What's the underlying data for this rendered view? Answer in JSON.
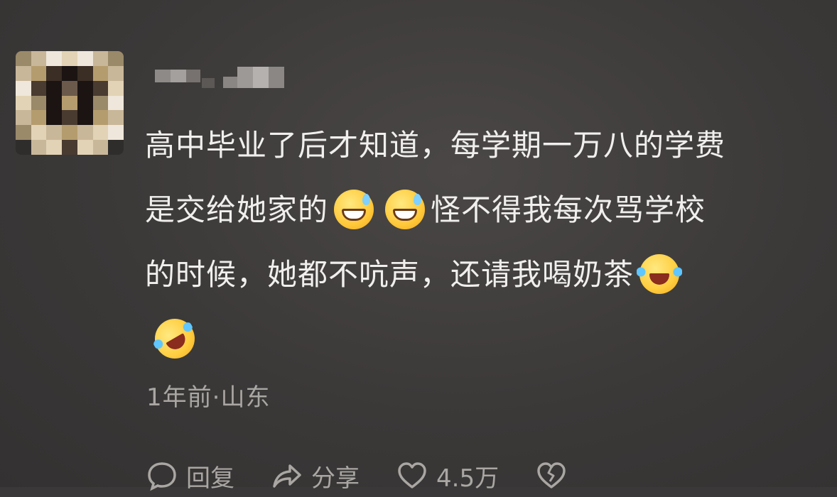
{
  "comment": {
    "content_lines": [
      "高中毕业了后才知道，每学期一万八的学费",
      "是交给她家的",
      "怪不得我每次骂学校",
      "的时候，她都不吭声，还请我喝奶茶"
    ],
    "emojis": [
      "grin-sweat-emoji",
      "grin-sweat-emoji",
      "laugh-cry-emoji",
      "rolling-laugh-emoji"
    ],
    "meta": "1年前·山东"
  },
  "actions": {
    "reply_label": "回复",
    "share_label": "分享",
    "like_count": "4.5万"
  }
}
